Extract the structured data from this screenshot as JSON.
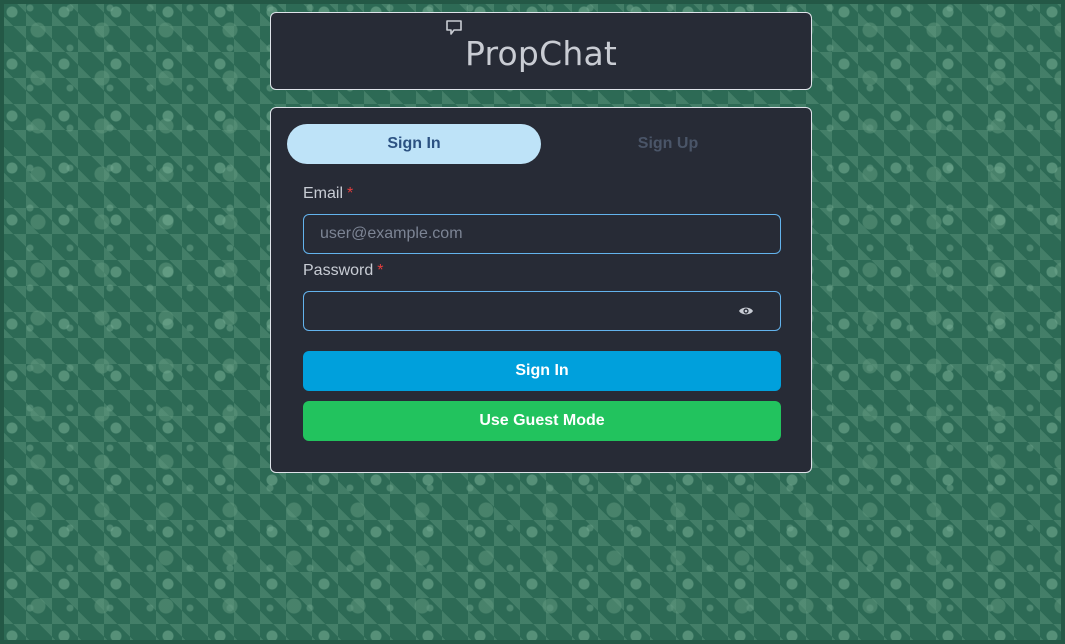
{
  "app": {
    "title": "PropChat",
    "logo_icon": "chat-bubble-icon"
  },
  "tabs": [
    {
      "label": "Sign In",
      "active": true
    },
    {
      "label": "Sign Up",
      "active": false
    }
  ],
  "form": {
    "email": {
      "label": "Email",
      "required_mark": "*",
      "placeholder": "user@example.com",
      "value": ""
    },
    "password": {
      "label": "Password",
      "required_mark": "*",
      "placeholder": "",
      "value": "",
      "toggle_icon": "eye-icon"
    }
  },
  "buttons": {
    "sign_in": "Sign In",
    "guest": "Use Guest Mode"
  },
  "colors": {
    "card_bg": "#272b36",
    "active_tab_bg": "#bee3f8",
    "active_tab_text": "#2c5282",
    "sign_in_button": "#00a0dc",
    "guest_button": "#22c35e",
    "input_border": "#63b3ed",
    "required": "#e53e3e",
    "background": "#2d6a55"
  }
}
